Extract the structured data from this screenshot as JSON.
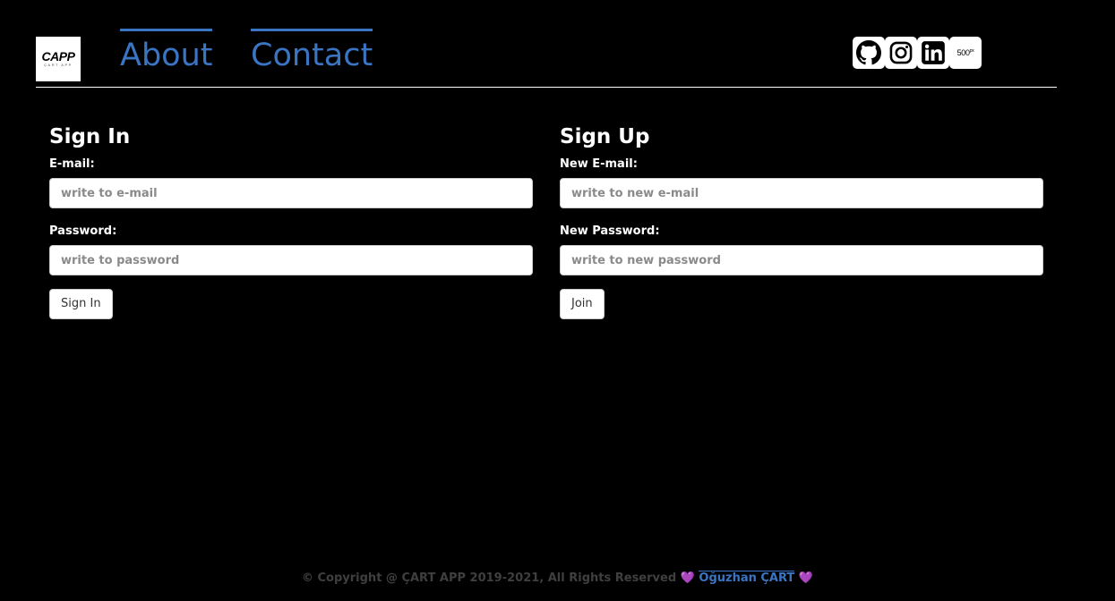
{
  "header": {
    "logo": {
      "main": "CAPP",
      "sub": "ÇART APP"
    },
    "nav": [
      {
        "label": "About"
      },
      {
        "label": "Contact"
      }
    ],
    "social": [
      {
        "icon": "github-icon"
      },
      {
        "icon": "instagram-icon"
      },
      {
        "icon": "linkedin-icon"
      },
      {
        "icon": "500px-icon",
        "label": "500",
        "sup": "px"
      }
    ]
  },
  "signin": {
    "title": "Sign In",
    "email_label": "E-mail:",
    "email_placeholder": "write to e-mail",
    "password_label": "Password:",
    "password_placeholder": "write to password",
    "button": "Sign In"
  },
  "signup": {
    "title": "Sign Up",
    "email_label": "New E-mail:",
    "email_placeholder": "write to new e-mail",
    "password_label": "New Password:",
    "password_placeholder": "write to new password",
    "button": "Join"
  },
  "footer": {
    "copyright": "© Copyright @ ÇART APP 2019-2021, All Rights Reserved",
    "author": "Oğuzhan ÇART",
    "heart": "💜"
  },
  "colors": {
    "background": "#000000",
    "accent": "#3a75c4",
    "heart": "#7b68ee"
  }
}
